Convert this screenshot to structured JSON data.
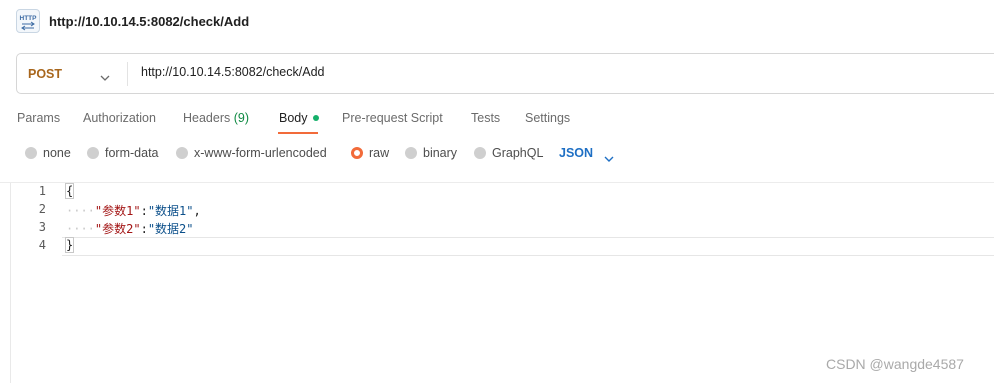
{
  "title": {
    "icon": "http-icon",
    "text": "http://10.10.14.5:8082/check/Add"
  },
  "request": {
    "method": "POST",
    "url": "http://10.10.14.5:8082/check/Add"
  },
  "tabs": [
    {
      "label": "Params"
    },
    {
      "label": "Authorization"
    },
    {
      "label": "Headers",
      "count": "(9)"
    },
    {
      "label": "Body",
      "active": true
    },
    {
      "label": "Pre-request Script"
    },
    {
      "label": "Tests"
    },
    {
      "label": "Settings"
    }
  ],
  "body_modes": {
    "options": [
      "none",
      "form-data",
      "x-www-form-urlencoded",
      "raw",
      "binary",
      "GraphQL"
    ],
    "selected": "raw",
    "language": "JSON"
  },
  "editor": {
    "line_numbers": [
      "1",
      "2",
      "3",
      "4"
    ],
    "open_brace": "{",
    "close_brace": "}",
    "indent": "····",
    "lines": [
      {
        "key": "\"参数1\"",
        "colon": ":",
        "value": "\"数据1\"",
        "comma": ","
      },
      {
        "key": "\"参数2\"",
        "colon": ":",
        "value": "\"数据2\"",
        "comma": ""
      }
    ]
  },
  "colors": {
    "method": "#a8661c",
    "accent": "#f26b3a",
    "body_dot": "#15b06a",
    "json": "#1e6fc4",
    "headers_count": "#0f8a43"
  },
  "watermark": "CSDN @wangde4587"
}
